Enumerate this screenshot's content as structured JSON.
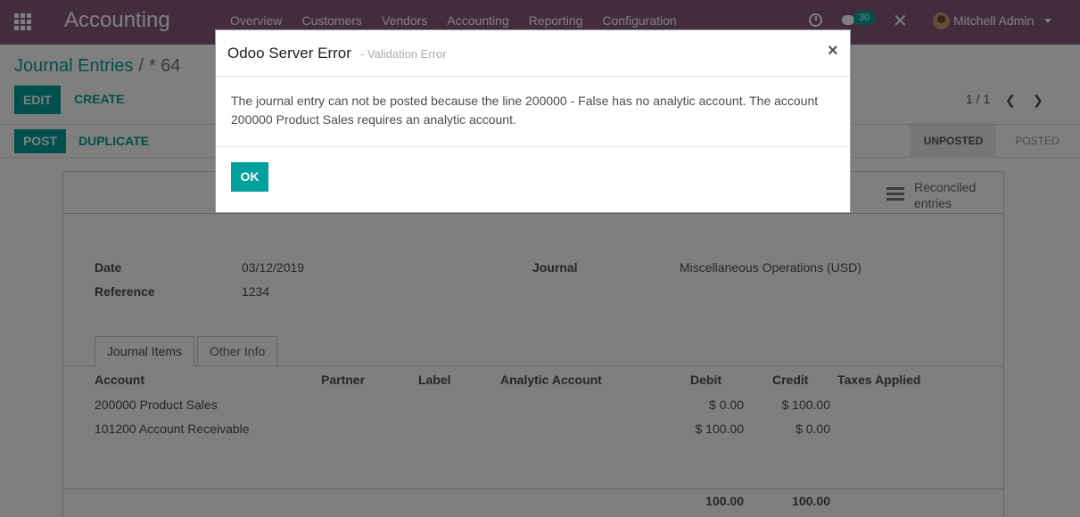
{
  "navbar": {
    "app_name": "Accounting",
    "menu": [
      "Overview",
      "Customers",
      "Vendors",
      "Accounting",
      "Reporting",
      "Configuration"
    ],
    "chat_count": "30",
    "user_name": "Mitchell Admin",
    "color": "#875a7b"
  },
  "control_panel": {
    "breadcrumb_parent": "Journal Entries",
    "breadcrumb_separator": "/",
    "breadcrumb_current": "* 64",
    "edit_label": "EDIT",
    "create_label": "CREATE",
    "pager": "1 / 1",
    "post_label": "POST",
    "duplicate_label": "DUPLICATE",
    "status_unposted": "UNPOSTED",
    "status_posted": "POSTED"
  },
  "form": {
    "smart_button": "Reconciled entries",
    "date_label": "Date",
    "date_value": "03/12/2019",
    "reference_label": "Reference",
    "reference_value": "1234",
    "journal_label": "Journal",
    "journal_value": "Miscellaneous Operations (USD)",
    "tabs": [
      "Journal Items",
      "Other Info"
    ],
    "columns": [
      "Account",
      "Partner",
      "Label",
      "Analytic Account",
      "Debit",
      "Credit",
      "Taxes Applied"
    ],
    "rows": [
      {
        "account": "200000 Product Sales",
        "debit": "$ 0.00",
        "credit": "$ 100.00"
      },
      {
        "account": "101200 Account Receivable",
        "debit": "$ 100.00",
        "credit": "$ 0.00"
      }
    ],
    "total_debit": "100.00",
    "total_credit": "100.00"
  },
  "dialog": {
    "title": "Odoo Server Error",
    "subtitle": "- Validation Error",
    "close": "×",
    "message": "The journal entry can not be posted because the line 200000 - False has no analytic account. The account 200000 Product Sales requires an analytic account.",
    "ok_label": "OK",
    "accent": "#00a09d"
  }
}
